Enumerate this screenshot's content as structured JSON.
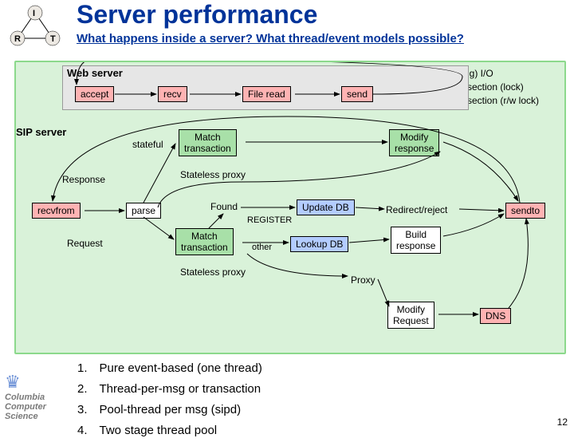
{
  "title": "Server performance",
  "subtitle": "What happens inside a server? What thread/event models possible?",
  "legend": {
    "l1": "(Blocking) I/O",
    "l2": "Critical section (lock)",
    "l3": "Critical section (r/w lock)",
    "colors": {
      "io": "#ff5a5a",
      "cs": "#7dd87d",
      "rw": "#9fc5ff"
    }
  },
  "web": {
    "title": "Web server",
    "n1": "accept",
    "n2": "recv",
    "n3": "File read",
    "n4": "send"
  },
  "sip": {
    "title": "SIP server",
    "stateful": "stateful",
    "match": "Match\ntransaction",
    "modify_resp": "Modify\nresponse",
    "response": "Response",
    "recvfrom": "recvfrom",
    "parse": "parse",
    "found": "Found",
    "register": "REGISTER",
    "update_db": "Update DB",
    "redirect": "Redirect/reject",
    "sendto": "sendto",
    "request": "Request",
    "match2": "Match\ntransaction",
    "other": "other",
    "lookup": "Lookup DB",
    "build": "Build\nresponse",
    "stateless1": "Stateless proxy",
    "stateless2": "Stateless proxy",
    "proxy": "Proxy",
    "modify_req": "Modify\nRequest",
    "dns": "DNS"
  },
  "models": {
    "items": [
      "Pure event-based (one thread)",
      "Thread-per-msg or transaction",
      "Pool-thread per msg (sipd)",
      "Two stage thread pool"
    ]
  },
  "irt": {
    "i": "I",
    "r": "R",
    "t": "T"
  },
  "cucs": "Columbia\nComputer\nScience",
  "page": "12"
}
